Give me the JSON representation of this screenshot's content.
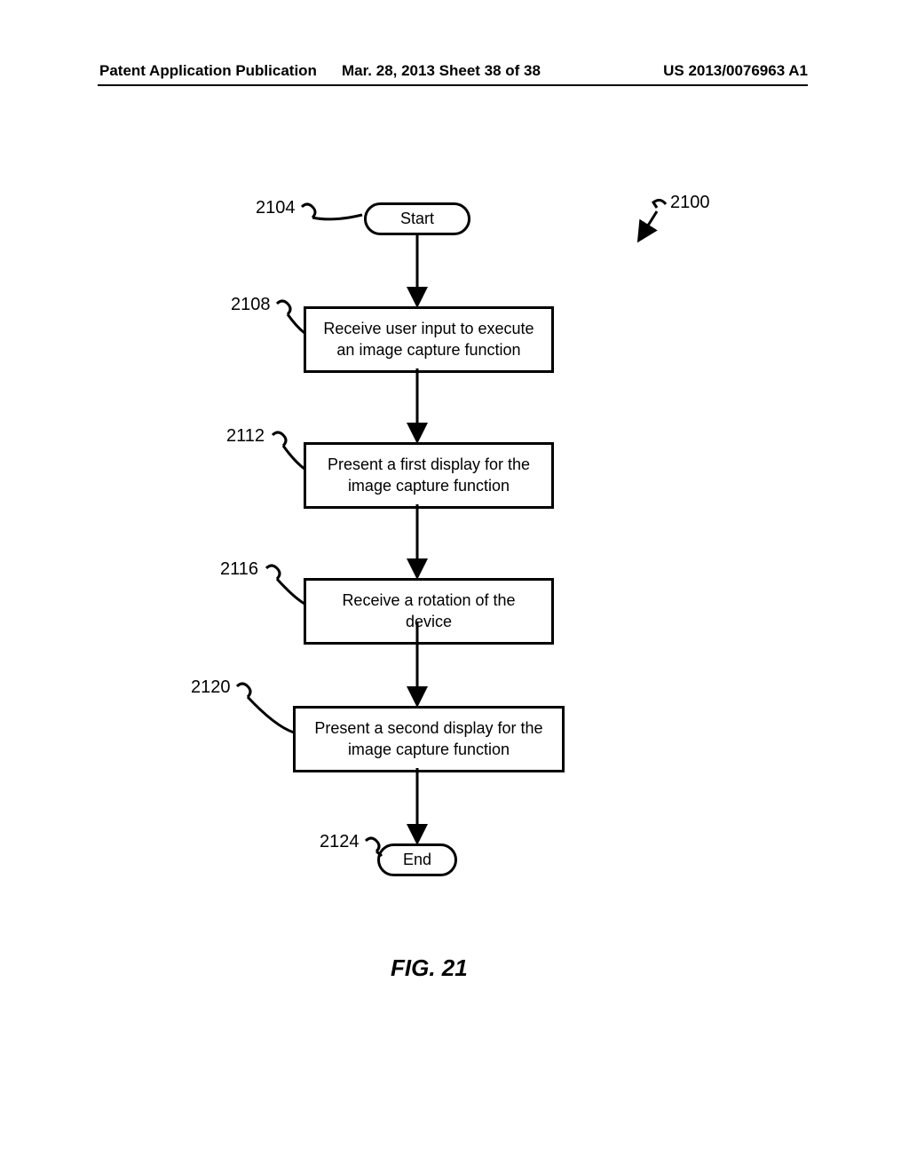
{
  "header": {
    "left": "Patent Application Publication",
    "mid": "Mar. 28, 2013  Sheet 38 of 38",
    "right": "US 2013/0076963 A1"
  },
  "refs": {
    "r2100": "2100",
    "r2104": "2104",
    "r2108": "2108",
    "r2112": "2112",
    "r2116": "2116",
    "r2120": "2120",
    "r2124": "2124"
  },
  "nodes": {
    "start": "Start",
    "step1": "Receive user input to execute an image capture function",
    "step2": "Present a first display for the image capture function",
    "step3": "Receive a rotation of the device",
    "step4": "Present a second display for the image capture function",
    "end": "End"
  },
  "figure": "FIG. 21"
}
